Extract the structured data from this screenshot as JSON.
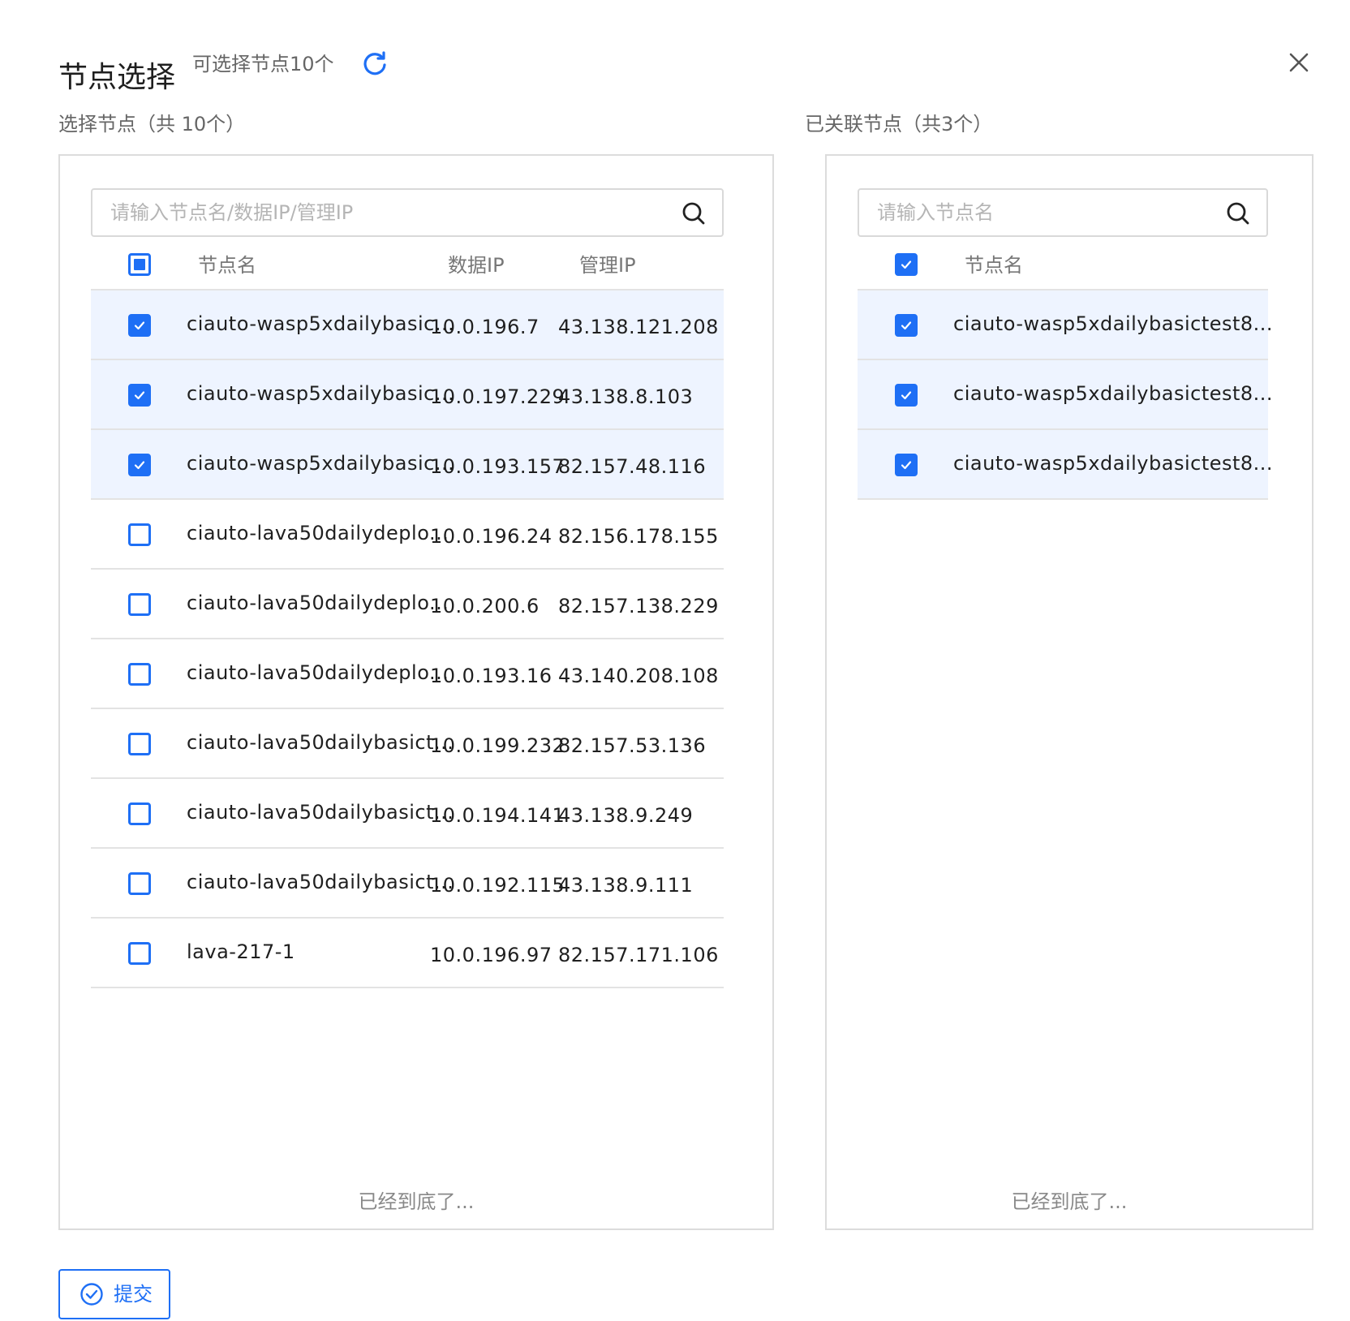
{
  "dialog": {
    "title": "节点选择",
    "subtitle": "可选择节点10个",
    "refresh_icon": "refresh-icon",
    "close_icon": "close-icon"
  },
  "left": {
    "label": "选择节点（共 10个）",
    "search_placeholder": "请输入节点名/数据IP/管理IP",
    "columns": [
      "节点名",
      "数据IP",
      "管理IP"
    ],
    "select_all_state": "partial",
    "rows": [
      {
        "name": "ciauto-wasp5xdailybasic...",
        "data_ip": "10.0.196.7",
        "mgmt_ip": "43.138.121.208",
        "checked": true
      },
      {
        "name": "ciauto-wasp5xdailybasic...",
        "data_ip": "10.0.197.229",
        "mgmt_ip": "43.138.8.103",
        "checked": true
      },
      {
        "name": "ciauto-wasp5xdailybasic...",
        "data_ip": "10.0.193.157",
        "mgmt_ip": "82.157.48.116",
        "checked": true
      },
      {
        "name": "ciauto-lava50dailydeplo...",
        "data_ip": "10.0.196.24",
        "mgmt_ip": "82.156.178.155",
        "checked": false
      },
      {
        "name": "ciauto-lava50dailydeplo...",
        "data_ip": "10.0.200.6",
        "mgmt_ip": "82.157.138.229",
        "checked": false
      },
      {
        "name": "ciauto-lava50dailydeplo...",
        "data_ip": "10.0.193.16",
        "mgmt_ip": "43.140.208.108",
        "checked": false
      },
      {
        "name": "ciauto-lava50dailybasict...",
        "data_ip": "10.0.199.232",
        "mgmt_ip": "82.157.53.136",
        "checked": false
      },
      {
        "name": "ciauto-lava50dailybasict...",
        "data_ip": "10.0.194.141",
        "mgmt_ip": "43.138.9.249",
        "checked": false
      },
      {
        "name": "ciauto-lava50dailybasict...",
        "data_ip": "10.0.192.115",
        "mgmt_ip": "43.138.9.111",
        "checked": false
      },
      {
        "name": "lava-217-1",
        "data_ip": "10.0.196.97",
        "mgmt_ip": "82.157.171.106",
        "checked": false
      }
    ],
    "end_note": "已经到底了..."
  },
  "right": {
    "label": "已关联节点（共3个）",
    "search_placeholder": "请输入节点名",
    "columns": [
      "节点名"
    ],
    "select_all_state": "checked",
    "rows": [
      {
        "name": "ciauto-wasp5xdailybasictest8...",
        "checked": true
      },
      {
        "name": "ciauto-wasp5xdailybasictest8...",
        "checked": true
      },
      {
        "name": "ciauto-wasp5xdailybasictest8...",
        "checked": true
      }
    ],
    "end_note": "已经到底了..."
  },
  "submit": {
    "label": "提交",
    "icon": "check-circle-icon"
  },
  "colors": {
    "accent": "#1e6ff5",
    "selected_row_bg": "#eef4ff"
  }
}
